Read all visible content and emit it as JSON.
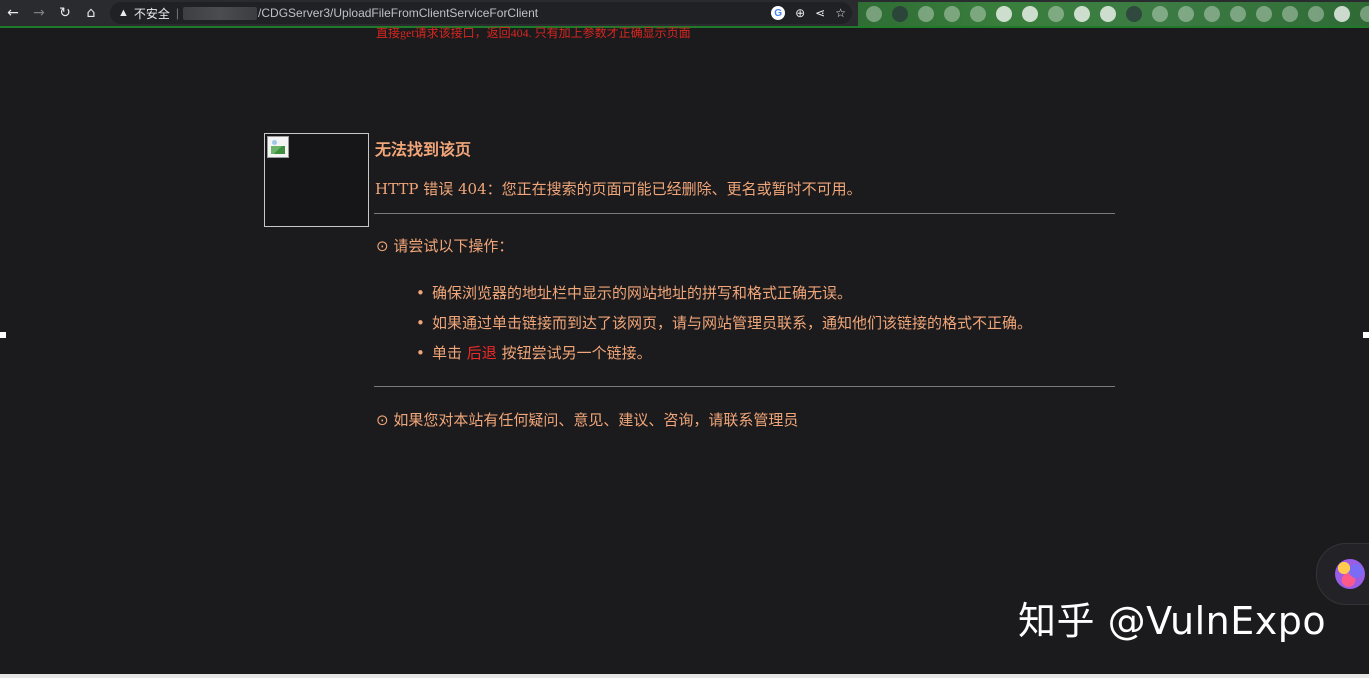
{
  "browser": {
    "security_label": "不安全",
    "url_path": "/CDGServer3/UploadFileFromClientServiceForClient"
  },
  "annotation": "直接get请求该接口，返回404. 只有加上参数才正确显示页面",
  "page": {
    "title": "无法找到该页",
    "subtitle": "HTTP 错误 404：您正在搜索的页面可能已经删除、更名或暂时不可用。",
    "try_heading": "⊙ 请尝试以下操作：",
    "items": [
      "确保浏览器的地址栏中显示的网站地址的拼写和格式正确无误。",
      "如果通过单击链接而到达了该网页，请与网站管理员联系，通知他们该链接的格式不正确。"
    ],
    "back_item": {
      "prefix": "单击 ",
      "link": "后退",
      "suffix": " 按钮尝试另一个链接。"
    },
    "contact": "⊙ 如果您对本站有任何疑问、意见、建议、咨询，请联系管理员"
  },
  "watermark": "知乎 @VulnExpo",
  "colors": {
    "text": "#f0a679",
    "link": "#ee2a2a",
    "annotation": "#d8261f",
    "background": "#1b1a1c"
  }
}
